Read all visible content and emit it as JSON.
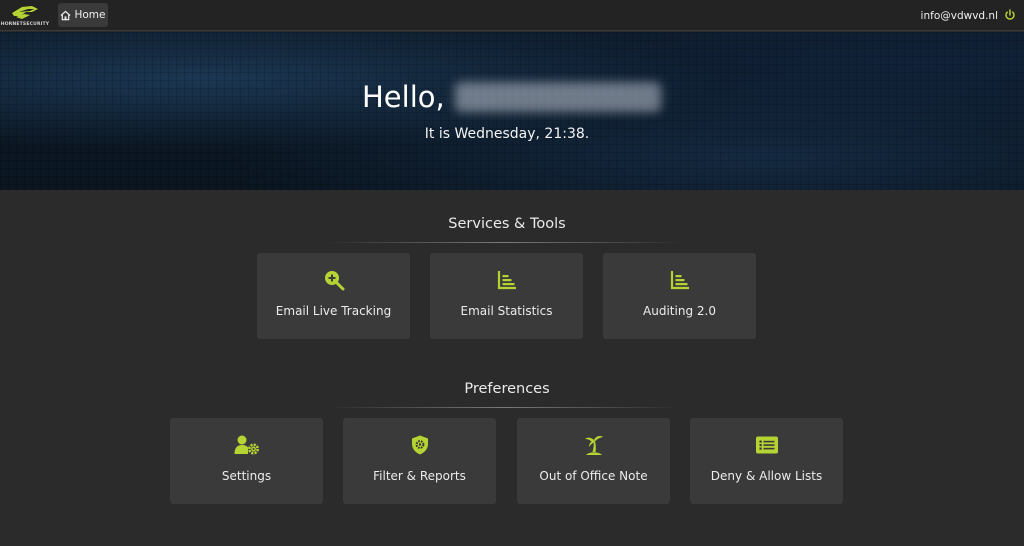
{
  "topbar": {
    "logo_text": "HORNETSECURITY",
    "home_label": "Home",
    "user_email": "info@vdwvd.nl"
  },
  "hero": {
    "greeting": "Hello,",
    "time_text": "It is Wednesday, 21:38."
  },
  "services": {
    "title": "Services & Tools",
    "tiles": [
      {
        "label": "Email Live Tracking",
        "icon": "search-plus-icon"
      },
      {
        "label": "Email Statistics",
        "icon": "bar-chart-icon"
      },
      {
        "label": "Auditing 2.0",
        "icon": "bar-chart-icon"
      }
    ]
  },
  "preferences": {
    "title": "Preferences",
    "tiles": [
      {
        "label": "Settings",
        "icon": "user-gear-icon"
      },
      {
        "label": "Filter & Reports",
        "icon": "shield-gear-icon"
      },
      {
        "label": "Out of Office Note",
        "icon": "palm-tree-icon"
      },
      {
        "label": "Deny & Allow Lists",
        "icon": "list-icon"
      }
    ]
  },
  "colors": {
    "accent": "#b6d334",
    "background": "#2b2b2b",
    "tile": "#3a3a3a",
    "topbar": "#232323"
  }
}
